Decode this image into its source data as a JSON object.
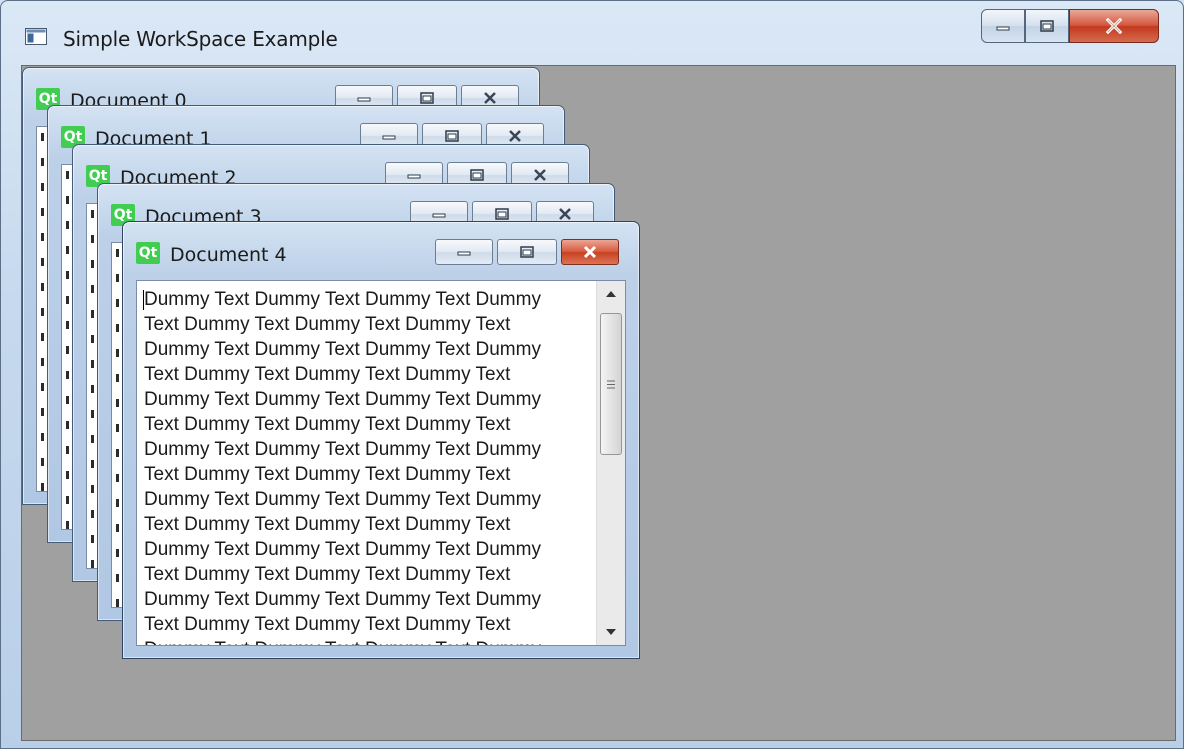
{
  "window": {
    "title": "Simple WorkSpace Example",
    "caption_buttons": [
      "minimize",
      "maximize",
      "close"
    ]
  },
  "documents": [
    {
      "title": "Document 0",
      "icon": "Qt"
    },
    {
      "title": "Document 1",
      "icon": "Qt"
    },
    {
      "title": "Document 2",
      "icon": "Qt"
    },
    {
      "title": "Document 3",
      "icon": "Qt"
    },
    {
      "title": "Document 4",
      "icon": "Qt"
    }
  ],
  "active_document": {
    "title": "Document 4",
    "icon": "Qt",
    "lines": [
      "Dummy Text Dummy Text Dummy Text Dummy",
      "Text Dummy Text Dummy Text Dummy Text",
      "Dummy Text Dummy Text Dummy Text Dummy",
      "Text Dummy Text Dummy Text Dummy Text",
      "Dummy Text Dummy Text Dummy Text Dummy",
      "Text Dummy Text Dummy Text Dummy Text",
      "Dummy Text Dummy Text Dummy Text Dummy",
      "Text Dummy Text Dummy Text Dummy Text",
      "Dummy Text Dummy Text Dummy Text Dummy",
      "Text Dummy Text Dummy Text Dummy Text",
      "Dummy Text Dummy Text Dummy Text Dummy",
      "Text Dummy Text Dummy Text Dummy Text",
      "Dummy Text Dummy Text Dummy Text Dummy",
      "Text Dummy Text Dummy Text Dummy Text",
      "Dummy Text Dummy Text Dummy Text Dummy"
    ],
    "scroll_position": 0
  },
  "colors": {
    "mdi_background": "#a0a0a0",
    "qt_green": "#41cd52",
    "close_red": "#c7421f"
  }
}
